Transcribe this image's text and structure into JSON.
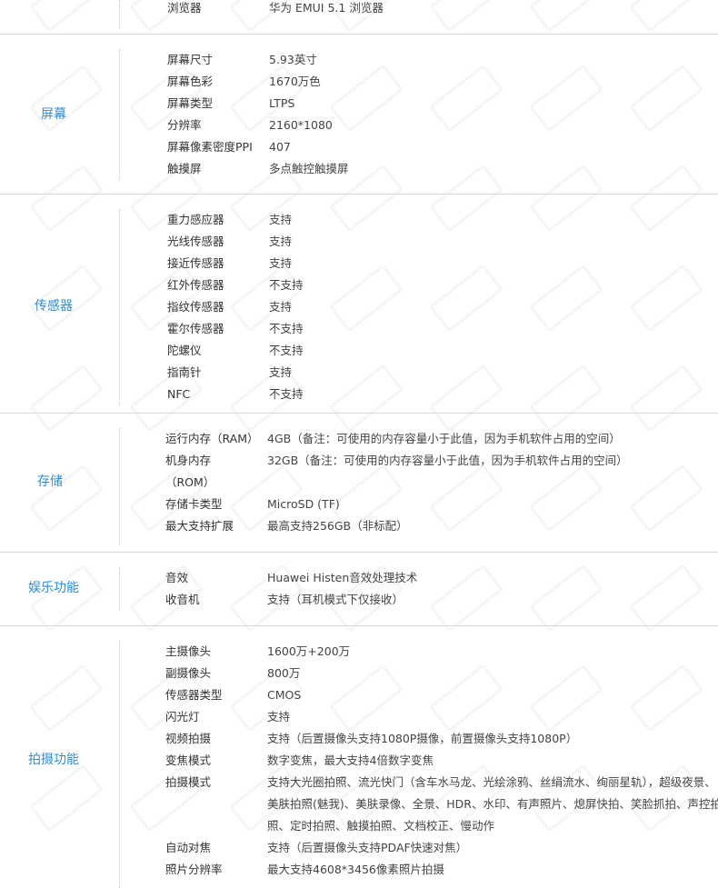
{
  "top_row": {
    "key": "浏览器",
    "value": "华为 EMUI 5.1 浏览器"
  },
  "sections": [
    {
      "label": "屏幕",
      "rows": [
        {
          "key": "屏幕尺寸",
          "value": "5.93英寸"
        },
        {
          "key": "屏幕色彩",
          "value": "1670万色"
        },
        {
          "key": "屏幕类型",
          "value": "LTPS"
        },
        {
          "key": "分辨率",
          "value": "2160*1080"
        },
        {
          "key": "屏幕像素密度PPI",
          "value": "407"
        },
        {
          "key": "触摸屏",
          "value": "多点触控触摸屏"
        }
      ]
    },
    {
      "label": "传感器",
      "rows": [
        {
          "key": "重力感应器",
          "value": "支持"
        },
        {
          "key": "光线传感器",
          "value": "支持"
        },
        {
          "key": "接近传感器",
          "value": "支持"
        },
        {
          "key": "红外传感器",
          "value": "不支持"
        },
        {
          "key": "指纹传感器",
          "value": "支持"
        },
        {
          "key": "霍尔传感器",
          "value": "不支持"
        },
        {
          "key": "陀螺仪",
          "value": "不支持"
        },
        {
          "key": "指南针",
          "value": "支持"
        },
        {
          "key": "NFC",
          "value": "不支持"
        }
      ]
    },
    {
      "label": "存储",
      "rows": [
        {
          "key": "运行内存（RAM）",
          "value": "4GB（备注：可使用的内存容量小于此值，因为手机软件占用的空间）"
        },
        {
          "key": "机身内存",
          "value": "32GB（备注：可使用的内存容量小于此值，因为手机软件占用的空间）"
        },
        {
          "key": "（ROM）",
          "value": ""
        },
        {
          "key": "存储卡类型",
          "value": "MicroSD (TF)"
        },
        {
          "key": "最大支持扩展",
          "value": "最高支持256GB（非标配）"
        }
      ]
    },
    {
      "label": "娱乐功能",
      "rows": [
        {
          "key": "音效",
          "value": "Huawei Histen音效处理技术"
        },
        {
          "key": "收音机",
          "value": "支持（耳机模式下仅接收）"
        }
      ]
    },
    {
      "label": "拍摄功能",
      "rows": [
        {
          "key": "主摄像头",
          "value": "1600万+200万"
        },
        {
          "key": "副摄像头",
          "value": "800万"
        },
        {
          "key": "传感器类型",
          "value": "CMOS"
        },
        {
          "key": "闪光灯",
          "value": "支持"
        },
        {
          "key": "视频拍摄",
          "value": "支持（后置摄像头支持1080P摄像，前置摄像头支持1080P）"
        },
        {
          "key": "变焦模式",
          "value": "数字变焦，最大支持4倍数字变焦"
        },
        {
          "key": "拍摄模式",
          "value": "支持大光圈拍照、流光快门（含车水马龙、光绘涂鸦、丝绢流水、绚丽星轨），超级夜景、"
        },
        {
          "key": "",
          "value": "美肤拍照(魅我)、美肤录像、全景、HDR、水印、有声照片、熄屏快拍、笑脸抓拍、声控拍"
        },
        {
          "key": "",
          "value": "照、定时拍照、触摸拍照、文档校正、慢动作"
        },
        {
          "key": "自动对焦",
          "value": "支持（后置摄像头支持PDAF快速对焦）"
        },
        {
          "key": "照片分辨率",
          "value": "最大支持4608*3456像素照片拍摄"
        }
      ]
    }
  ]
}
